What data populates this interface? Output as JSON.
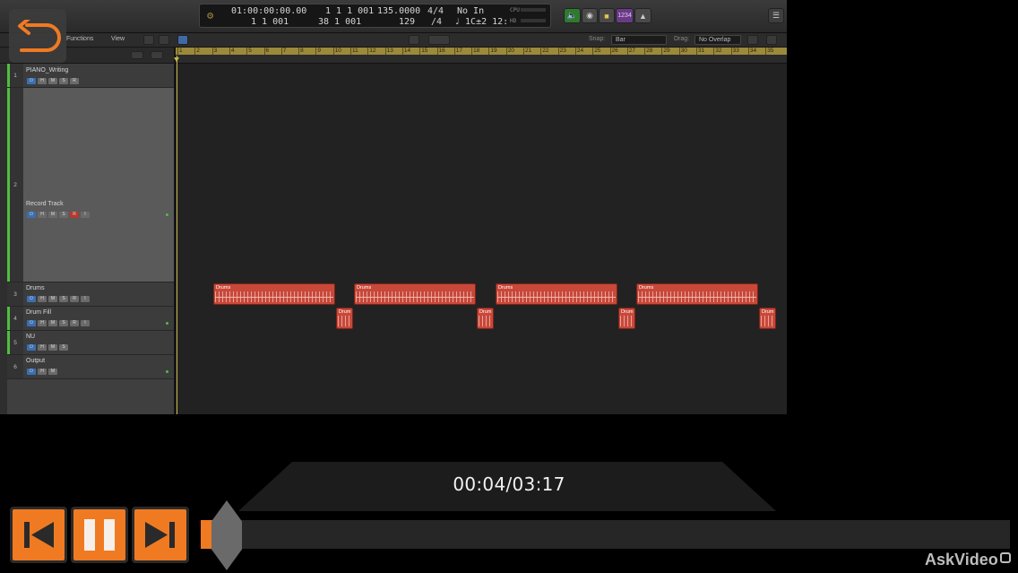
{
  "lcd": {
    "smpte": "01:00:00:00.00",
    "bars_beats": "1  1  1  001",
    "position2": "1  1  001",
    "end": "38  1  001",
    "tempo": "135.0000",
    "tempo2": "129",
    "sig": "4/4",
    "sig2": "/4",
    "in_label": "No In",
    "out_label": "♩ 1C±2 12:",
    "cpu": "CPU",
    "hd": "HD"
  },
  "topbar": {
    "tuner_label": "1234"
  },
  "toolbar2": {
    "functions": "Functions",
    "view": "View",
    "snap_label": "Snap:",
    "snap_value": "Bar",
    "drag_label": "Drag:",
    "drag_value": "No Overlap"
  },
  "ruler": {
    "bars": [
      "1",
      "2",
      "3",
      "4",
      "5",
      "6",
      "7",
      "8",
      "9",
      "10",
      "11",
      "12",
      "13",
      "14",
      "15",
      "16",
      "17",
      "18",
      "19",
      "20",
      "21",
      "22",
      "23",
      "24",
      "25",
      "26",
      "27",
      "28",
      "29",
      "30",
      "31",
      "32",
      "33",
      "34",
      "35"
    ]
  },
  "tracks": [
    {
      "num": "1",
      "name": "PIANO_Writing",
      "buttons": [
        "⏻",
        "H",
        "M",
        "S",
        "R"
      ]
    },
    {
      "num": "2",
      "name": "Record Track",
      "buttons": [
        "⏻",
        "H",
        "M",
        "S",
        "R",
        "I"
      ]
    },
    {
      "num": "3",
      "name": "Drums",
      "buttons": [
        "⏻",
        "H",
        "M",
        "S",
        "R",
        "I"
      ]
    },
    {
      "num": "4",
      "name": "Drum Fill",
      "buttons": [
        "⏻",
        "H",
        "M",
        "S",
        "R",
        "I"
      ]
    },
    {
      "num": "5",
      "name": "NU",
      "buttons": [
        "⏻",
        "H",
        "M",
        "S"
      ]
    },
    {
      "num": "6",
      "name": "Output",
      "buttons": [
        "⏻",
        "H",
        "M"
      ]
    }
  ],
  "regions": {
    "drums_label": "Drums",
    "fill_label": "Drum"
  },
  "player": {
    "time": "00:04/03:17",
    "progress": 0.02
  },
  "brand": "AskVideo",
  "colors": {
    "accent": "#f07a22",
    "region": "#c8483a",
    "track_green": "#4fbf3f",
    "cycle": "#9b8a3a"
  }
}
